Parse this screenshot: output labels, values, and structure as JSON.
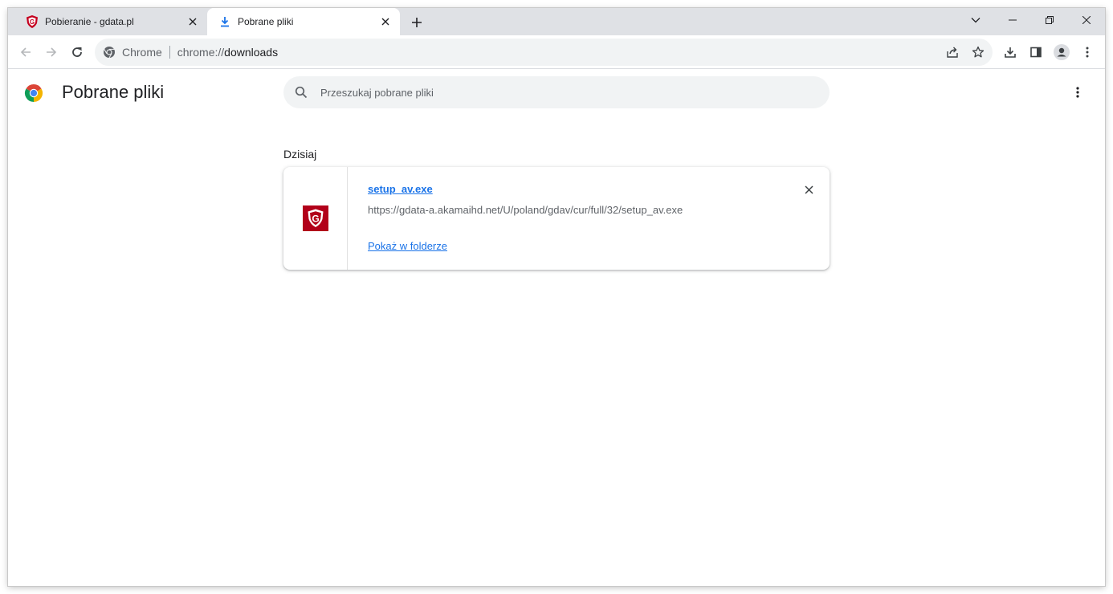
{
  "tabs": [
    {
      "title": "Pobieranie - gdata.pl",
      "active": false,
      "favicon": "gdata-shield-icon"
    },
    {
      "title": "Pobrane pliki",
      "active": true,
      "favicon": "download-icon"
    }
  ],
  "toolbar": {
    "omnibox": {
      "chip": "Chrome",
      "scheme": "chrome://",
      "host": "downloads"
    }
  },
  "page": {
    "title": "Pobrane pliki",
    "search": {
      "placeholder": "Przeszukaj pobrane pliki"
    }
  },
  "downloads": {
    "date_header": "Dzisiaj",
    "items": [
      {
        "filename": "setup_av.exe",
        "url": "https://gdata-a.akamaihd.net/U/poland/gdav/cur/full/32/setup_av.exe",
        "action": "Pokaż w folderze",
        "icon": "gdata-shield-icon"
      }
    ]
  },
  "colors": {
    "tabstrip": "#dfe1e5",
    "link": "#1a73e8",
    "gdata_red": "#b2001a"
  }
}
